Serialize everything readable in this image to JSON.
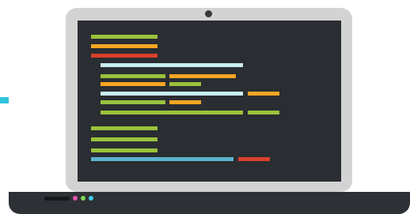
{
  "colors": {
    "accent_cyan": "#2ec4dc",
    "lid": "#d3d3d3",
    "screen": "#2a2d31",
    "base": "#2d3035",
    "code_green": "#9bc23c",
    "code_orange": "#f5a623",
    "code_red": "#d9402b",
    "code_light": "#c8eef2",
    "code_blue": "#5bb5d0",
    "led_pink": "#e056a8",
    "led_green": "#7ed957",
    "led_cyan": "#3fcde8"
  },
  "icons": {
    "camera": "webcam-icon",
    "slot": "trackpad-slot-icon",
    "leds": [
      "status-led-pink-icon",
      "status-led-green-icon",
      "status-led-cyan-icon"
    ]
  }
}
